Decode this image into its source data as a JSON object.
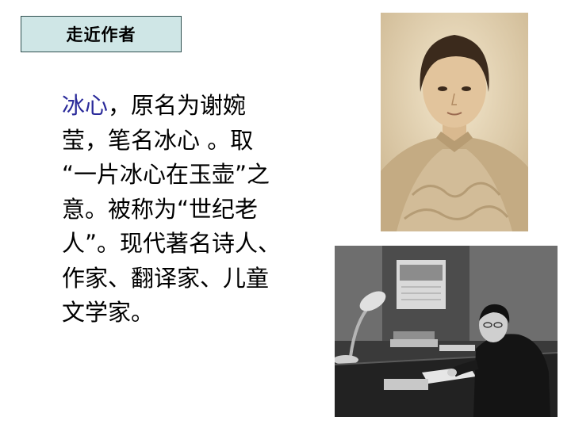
{
  "header": {
    "title": "走近作者"
  },
  "body": {
    "lines": [
      {
        "highlight": "冰心",
        "rest": "，原名为谢婉"
      },
      {
        "text": "莹，笔名冰心 。取"
      },
      {
        "text": "“一片冰心在玉壶”之"
      },
      {
        "text": "意。被称为“世纪老"
      },
      {
        "text": "人”。现代著名诗人、"
      },
      {
        "text": "作家、翻译家、儿童"
      },
      {
        "text": "文学家。"
      }
    ]
  },
  "colors": {
    "title_bg": "#cfe6e6",
    "highlight_text": "#2a2a9a",
    "portrait_tone": "#d8c3a0",
    "writing_photo_tone": "#2f2f2f"
  }
}
